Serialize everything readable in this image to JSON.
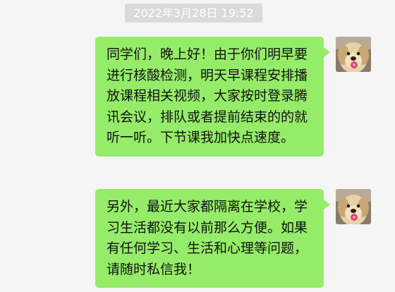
{
  "timestamp": "2022年3月28日 19:52",
  "messages": [
    {
      "sender": "self",
      "text": "同学们，晚上好！由于你们明早要进行核酸检测，明天早课程安排播放课程相关视频，大家按时登录腾讯会议，排队或者提前结束的的就听一听。下节课我加快点速度。"
    },
    {
      "sender": "self",
      "text": "另外，最近大家都隔离在学校，学习生活都没有以前那么方便。如果有任何学习、生活和心理等问题，请随时私信我！"
    }
  ],
  "colors": {
    "background": "#f5f5f5",
    "bubble": "#95ec69",
    "timestamp_bg": "#dadada"
  },
  "avatar_icon": "golden-retriever-avatar-icon"
}
